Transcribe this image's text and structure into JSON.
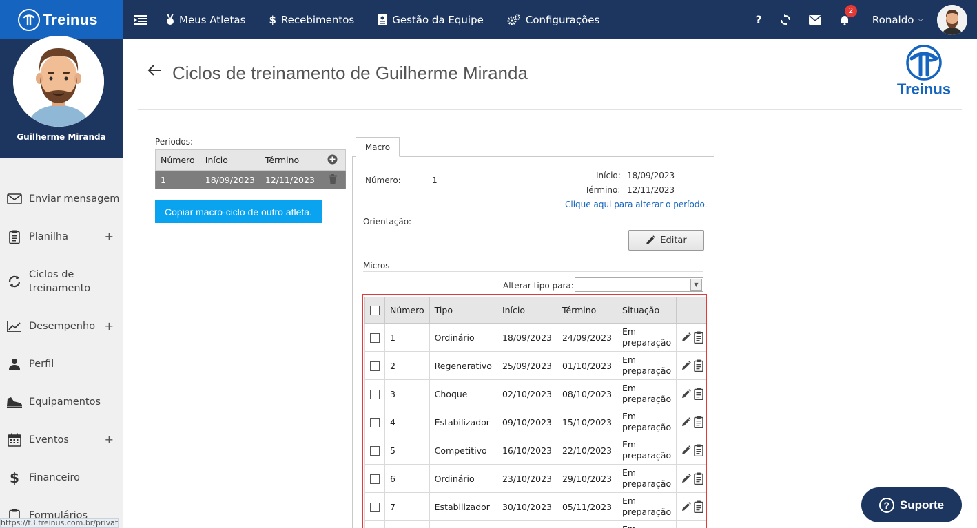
{
  "brand": {
    "name": "Treinus"
  },
  "nav": {
    "items": [
      {
        "label": "Meus Atletas",
        "icon": "medal-icon"
      },
      {
        "label": "Recebimentos",
        "icon": "dollar-icon"
      },
      {
        "label": "Gestão da Equipe",
        "icon": "id-card-icon"
      },
      {
        "label": "Configurações",
        "icon": "gears-icon"
      }
    ]
  },
  "topbar": {
    "help": "?",
    "notifications_count": "2",
    "user_name": "Ronaldo"
  },
  "sidebar": {
    "athlete_name": "Guilherme Miranda",
    "items": [
      {
        "label": "Enviar mensagem"
      },
      {
        "label": "Planilha",
        "expand": "+"
      },
      {
        "label": "Ciclos de treinamento"
      },
      {
        "label": "Desempenho",
        "expand": "+"
      },
      {
        "label": "Perfil"
      },
      {
        "label": "Equipamentos"
      },
      {
        "label": "Eventos",
        "expand": "+"
      },
      {
        "label": "Financeiro"
      },
      {
        "label": "Formulários"
      }
    ],
    "status_url": "https://t3.treinus.com.br/private"
  },
  "page": {
    "title": "Ciclos de treinamento de Guilherme Miranda",
    "logo_text": "Treinus"
  },
  "periods": {
    "label": "Períodos:",
    "columns": [
      "Número",
      "Início",
      "Término"
    ],
    "rows": [
      {
        "numero": "1",
        "inicio": "18/09/2023",
        "termino": "12/11/2023"
      }
    ],
    "copy_button": "Copiar macro-ciclo de outro atleta."
  },
  "macro": {
    "tab": "Macro",
    "numero_label": "Número:",
    "numero_value": "1",
    "inicio_label": "Início:",
    "inicio_value": "18/09/2023",
    "termino_label": "Término:",
    "termino_value": "12/11/2023",
    "change_period_link": "Clique aqui para alterar o período.",
    "orientacao_label": "Orientação:",
    "edit_button": "Editar",
    "micros_label": "Micros",
    "alterar_tipo_label": "Alterar tipo para:",
    "alterar_tipo_value": ""
  },
  "micros": {
    "columns": [
      "Número",
      "Tipo",
      "Início",
      "Término",
      "Situação"
    ],
    "rows": [
      {
        "numero": "1",
        "tipo": "Ordinário",
        "inicio": "18/09/2023",
        "termino": "24/09/2023",
        "sit1": "Em",
        "sit2": "preparação"
      },
      {
        "numero": "2",
        "tipo": "Regenerativo",
        "inicio": "25/09/2023",
        "termino": "01/10/2023",
        "sit1": "Em",
        "sit2": "preparação"
      },
      {
        "numero": "3",
        "tipo": "Choque",
        "inicio": "02/10/2023",
        "termino": "08/10/2023",
        "sit1": "Em",
        "sit2": "preparação"
      },
      {
        "numero": "4",
        "tipo": "Estabilizador",
        "inicio": "09/10/2023",
        "termino": "15/10/2023",
        "sit1": "Em",
        "sit2": "preparação"
      },
      {
        "numero": "5",
        "tipo": "Competitivo",
        "inicio": "16/10/2023",
        "termino": "22/10/2023",
        "sit1": "Em",
        "sit2": "preparação"
      },
      {
        "numero": "6",
        "tipo": "Ordinário",
        "inicio": "23/10/2023",
        "termino": "29/10/2023",
        "sit1": "Em",
        "sit2": "preparação"
      },
      {
        "numero": "7",
        "tipo": "Estabilizador",
        "inicio": "30/10/2023",
        "termino": "05/11/2023",
        "sit1": "Em",
        "sit2": "preparação"
      },
      {
        "numero": "",
        "tipo": "",
        "inicio": "",
        "termino": "",
        "sit1": "Em",
        "sit2": ""
      }
    ]
  },
  "support": {
    "label": "Suporte"
  },
  "colors": {
    "topbar": "#1c3660",
    "brand_bg": "#1565c0",
    "accent": "#0aa3f0",
    "highlight_border": "#e23b3b",
    "badge": "#e53935"
  }
}
